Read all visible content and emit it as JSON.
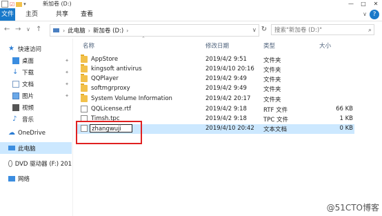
{
  "window": {
    "title": "新加卷 (D:)",
    "controls": [
      "—",
      "□",
      "✕"
    ]
  },
  "ribbon": {
    "tabs": [
      "文件",
      "主页",
      "共享",
      "查看"
    ],
    "help": "?",
    "expand": "∨"
  },
  "nav": {
    "back": "←",
    "forward": "→",
    "recent": "∨",
    "up": "↑"
  },
  "address": {
    "segments": [
      "此电脑",
      "新加卷 (D:)"
    ],
    "refresh": "↻"
  },
  "search": {
    "placeholder": "搜索\"新加卷 (D:)\""
  },
  "sidebar": {
    "items": [
      {
        "label": "快速访问",
        "icon": "star-icon"
      },
      {
        "label": "桌面",
        "icon": "desktop-icon",
        "pinned": true
      },
      {
        "label": "下载",
        "icon": "download-icon",
        "pinned": true
      },
      {
        "label": "文档",
        "icon": "document-icon",
        "pinned": true
      },
      {
        "label": "图片",
        "icon": "picture-icon",
        "pinned": true
      },
      {
        "label": "视频",
        "icon": "video-icon"
      },
      {
        "label": "音乐",
        "icon": "music-icon"
      },
      {
        "label": "OneDrive",
        "icon": "cloud-icon"
      },
      {
        "label": "此电脑",
        "icon": "computer-icon",
        "selected": true
      },
      {
        "label": "DVD 驱动器 (F:) 201",
        "icon": "dvd-icon"
      },
      {
        "label": "网络",
        "icon": "network-icon"
      }
    ]
  },
  "columns": {
    "name": "名称",
    "modified": "修改日期",
    "type": "类型",
    "size": "大小"
  },
  "files": [
    {
      "name": "AppStore",
      "modified": "2019/4/2 9:51",
      "type": "文件夹",
      "size": "",
      "kind": "folder"
    },
    {
      "name": "kingsoft antivirus",
      "modified": "2019/4/10 20:16",
      "type": "文件夹",
      "size": "",
      "kind": "folder"
    },
    {
      "name": "QQPlayer",
      "modified": "2019/4/2 9:49",
      "type": "文件夹",
      "size": "",
      "kind": "folder"
    },
    {
      "name": "softmgrproxy",
      "modified": "2019/4/2 9:49",
      "type": "文件夹",
      "size": "",
      "kind": "folder"
    },
    {
      "name": "System Volume Information",
      "modified": "2019/4/2 20:17",
      "type": "文件夹",
      "size": "",
      "kind": "folder"
    },
    {
      "name": "QQLicense.rtf",
      "modified": "2019/4/2 9:18",
      "type": "RTF 文件",
      "size": "66 KB",
      "kind": "doc"
    },
    {
      "name": "Timsh.tpc",
      "modified": "2019/4/2 9:18",
      "type": "TPC 文件",
      "size": "1 KB",
      "kind": "doc"
    },
    {
      "name": "zhangwuji",
      "modified": "2019/4/10 20:42",
      "type": "文本文档",
      "size": "0 KB",
      "kind": "doc",
      "renaming": true
    }
  ],
  "watermark": "@51CTO博客",
  "colors": {
    "accent": "#1979ca",
    "selection": "#cce8ff",
    "highlight_box": "#e02020",
    "folder": "#f2c14b"
  }
}
